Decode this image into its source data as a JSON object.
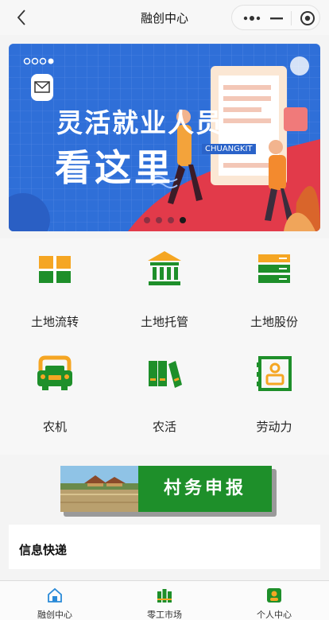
{
  "navbar": {
    "title": "融创中心"
  },
  "banner": {
    "title_line1": "灵活就业人员",
    "title_line2": "看这里",
    "tag": "CHUANGKIT",
    "dots_count": 4,
    "active_dot": 3
  },
  "grid": {
    "items": [
      {
        "label": "土地流转",
        "icon": "box-icon"
      },
      {
        "label": "土地托管",
        "icon": "bank-icon"
      },
      {
        "label": "土地股份",
        "icon": "server-stack-icon"
      },
      {
        "label": "农机",
        "icon": "tractor-icon"
      },
      {
        "label": "农活",
        "icon": "tools-icon"
      },
      {
        "label": "劳动力",
        "icon": "id-card-icon"
      }
    ]
  },
  "report": {
    "label": "村务申报"
  },
  "info": {
    "title": "信息快递"
  },
  "tabbar": {
    "items": [
      {
        "label": "融创中心",
        "icon": "home-icon"
      },
      {
        "label": "零工市场",
        "icon": "market-icon"
      },
      {
        "label": "个人中心",
        "icon": "profile-icon"
      }
    ]
  },
  "colors": {
    "green": "#1e8f2a",
    "orange": "#f5a623",
    "banner_blue": "#2f6fd8"
  }
}
